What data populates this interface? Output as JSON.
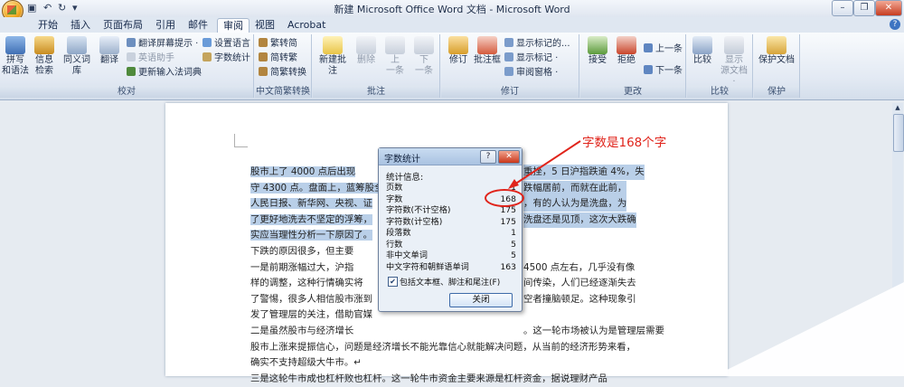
{
  "window": {
    "title": "新建 Microsoft Office Word 文档 - Microsoft Word"
  },
  "tabs": [
    "开始",
    "插入",
    "页面布局",
    "引用",
    "邮件",
    "审阅",
    "视图",
    "Acrobat"
  ],
  "active_tab": "审阅",
  "ribbon": {
    "proofing": {
      "label": "校对",
      "spelling": "拼写\n和语法",
      "research": "信息\n检索",
      "thesaurus": "同义词库",
      "translate": "翻译",
      "translate_tip": "翻译屏幕提示 ·",
      "english_helper": "英语助手",
      "update_ime": "更新输入法词典",
      "set_language": "设置语言",
      "word_count": "字数统计"
    },
    "chinese_conversion": {
      "label": "中文简繁转换",
      "to_simplified": "繁转简",
      "to_traditional": "简转繁",
      "convert": "简繁转换"
    },
    "comments": {
      "label": "批注",
      "new": "新建批注",
      "delete": "删除",
      "previous": "上\n一条",
      "next": "下\n一条"
    },
    "tracking": {
      "label": "修订",
      "track_changes": "修订",
      "balloons": "批注框",
      "show_final": "显示标记的...",
      "show_markup": "显示标记 ·",
      "reviewing_pane": "审阅窗格 ·"
    },
    "changes": {
      "label": "更改",
      "accept": "接受",
      "reject": "拒绝",
      "previous": "上一条",
      "next": "下一条"
    },
    "compare": {
      "label": "比较",
      "compare": "比较",
      "show_source": "显示\n源文档 ·"
    },
    "protect": {
      "label": "保护",
      "protect_doc": "保护文档"
    }
  },
  "document": {
    "lines": [
      {
        "text": "股市上了 4000 点后出现",
        "tail": "重挫，5 日沪指跌逾 4%，失",
        "hl": true
      },
      {
        "text": "守 4300 点。盘面上，蓝筹股全",
        "tail": "跌幅居前，而就在此前，",
        "hl": true
      },
      {
        "text": "人民日报、新华网、央视、证",
        "tail": "，有的人认为是洗盘，为",
        "hl": true
      },
      {
        "text": "了更好地洗去不坚定的浮筹，",
        "tail": "洗盘还是见顶，这次大跌确",
        "hl": true
      },
      {
        "text": "实应当理性分析一下原因了。",
        "tail": "",
        "hl": true
      },
      {
        "text": "    下跌的原因很多，但主要",
        "tail": "",
        "hl": false
      },
      {
        "text": "    一是前期涨幅过大，沪指",
        "tail": "4500 点左右，几乎没有像",
        "hl": false
      },
      {
        "text": "样的调整，这种行情确实将",
        "tail": "间传染，人们已经逐渐失去",
        "hl": false
      },
      {
        "text": "了警惕，很多人相信股市涨到",
        "tail": "空者撞脑顿足。这种现象引",
        "hl": false
      },
      {
        "text": "发了管理层的关注，借助官媒",
        "tail": "",
        "hl": false
      },
      {
        "text": "    二是虽然股市与经济增长",
        "tail": "。这一轮市场被认为是管理层需要",
        "hl": false
      },
      {
        "text": "股市上涨来提振信心，问题是经济增长不能光靠信心就能解决问题，从当前的经济形势来看，",
        "tail": "",
        "hl": false
      },
      {
        "text": "确实不支持超级大牛市。↵",
        "tail": "",
        "hl": false
      },
      {
        "text": "    三是这轮牛市成也杠杆败也杠杆。这一轮牛市资金主要来源是杠杆资金，据说理财产品",
        "tail": "",
        "hl": false
      }
    ]
  },
  "word_count_dialog": {
    "title": "字数统计",
    "section": "统计信息:",
    "rows": [
      {
        "label": "页数",
        "value": "1"
      },
      {
        "label": "字数",
        "value": "168"
      },
      {
        "label": "字符数(不计空格)",
        "value": "175"
      },
      {
        "label": "字符数(计空格)",
        "value": "175"
      },
      {
        "label": "段落数",
        "value": "1"
      },
      {
        "label": "行数",
        "value": "5"
      },
      {
        "label": "非中文单词",
        "value": "5"
      },
      {
        "label": "中文字符和朝鲜语单词",
        "value": "163"
      }
    ],
    "checkbox_label": "包括文本框、脚注和尾注(F)",
    "checkbox_checked": true,
    "close_button": "关闭"
  },
  "annotation": {
    "text": "字数是168个字",
    "color": "#e0241b"
  }
}
